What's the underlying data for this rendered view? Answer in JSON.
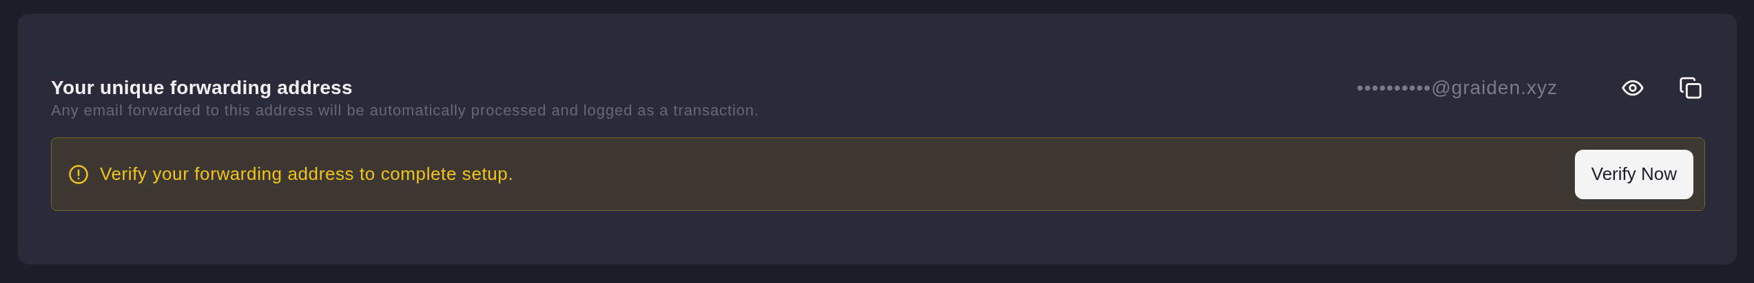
{
  "card": {
    "title": "Your unique forwarding address",
    "address": "••••••••••@graiden.xyz",
    "description": "Any email forwarded to this address will be automatically processed and logged as a transaction."
  },
  "alert": {
    "message": "Verify your forwarding address to complete setup.",
    "button": "Verify Now"
  }
}
